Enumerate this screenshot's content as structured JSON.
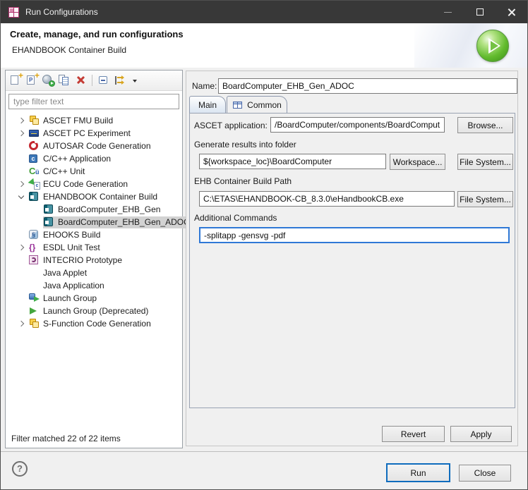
{
  "window": {
    "title": "Run Configurations"
  },
  "header": {
    "title": "Create, manage, and run configurations",
    "subtitle": "EHANDBOOK Container Build"
  },
  "left_panel": {
    "toolbar": [
      {
        "name": "new-launch-configuration-button",
        "icon": "new-config-icon"
      },
      {
        "name": "new-launch-prototype-button",
        "icon": "new-prototype-icon"
      },
      {
        "name": "export-launch-configurations-button",
        "icon": "export-icon"
      },
      {
        "name": "duplicate-launch-configuration-button",
        "icon": "duplicate-icon"
      },
      {
        "name": "delete-launch-configuration-button",
        "icon": "delete-icon"
      },
      {
        "separator": true
      },
      {
        "name": "collapse-all-button",
        "icon": "collapse-all-icon"
      },
      {
        "name": "filter-launch-configurations-button",
        "icon": "filter-icon"
      },
      {
        "name": "toolbar-menu-button",
        "icon": "dropdown-arrow-icon"
      }
    ],
    "filter_placeholder": "type filter text",
    "tree": [
      {
        "label": "ASCET FMU Build",
        "icon": "ascet-fmu-icon",
        "chevron": "collapsed"
      },
      {
        "label": "ASCET PC Experiment",
        "icon": "ascet-pc-icon",
        "chevron": "collapsed"
      },
      {
        "label": "AUTOSAR Code Generation",
        "icon": "autosar-icon"
      },
      {
        "label": "C/C++ Application",
        "icon": "c-application-icon"
      },
      {
        "label": "C/C++ Unit",
        "icon": "c-unit-icon"
      },
      {
        "label": "ECU Code Generation",
        "icon": "ecu-codegen-icon",
        "chevron": "collapsed"
      },
      {
        "label": "EHANDBOOK Container Build",
        "icon": "ehandbook-icon",
        "chevron": "expanded"
      },
      {
        "label": "BoardComputer_EHB_Gen",
        "icon": "ehandbook-icon",
        "indent": 1
      },
      {
        "label": "BoardComputer_EHB_Gen_ADOC",
        "icon": "ehandbook-icon",
        "indent": 1,
        "selected": true
      },
      {
        "label": "EHOOKS Build",
        "icon": "ehooks-icon"
      },
      {
        "label": "ESDL Unit Test",
        "icon": "esdl-icon",
        "chevron": "collapsed"
      },
      {
        "label": "INTECRIO Prototype",
        "icon": "intecrio-icon"
      },
      {
        "label": "Java Applet",
        "icon": null
      },
      {
        "label": "Java Application",
        "icon": null
      },
      {
        "label": "Launch Group",
        "icon": "launch-group-icon"
      },
      {
        "label": "Launch Group (Deprecated)",
        "icon": "launch-group-deprecated-icon"
      },
      {
        "label": "S-Function Code Generation",
        "icon": "s-function-icon",
        "chevron": "collapsed"
      }
    ],
    "status": "Filter matched 22 of 22 items"
  },
  "editor": {
    "name_label": "Name:",
    "name_value": "BoardComputer_EHB_Gen_ADOC",
    "tabs": [
      {
        "label": "Main",
        "active": true
      },
      {
        "label": "Common",
        "icon": "table-icon"
      }
    ],
    "ascet_label": "ASCET application:",
    "ascet_value": "/BoardComputer/components/BoardComput",
    "browse_button": "Browse...",
    "results_label": "Generate results into folder",
    "results_value": "${workspace_loc}\\BoardComputer",
    "workspace_button": "Workspace...",
    "file_system_button": "File System...",
    "ehb_label": "EHB Container Build Path",
    "ehb_value": "C:\\ETAS\\EHANDBOOK-CB_8.3.0\\eHandbookCB.exe",
    "commands_label": "Additional Commands",
    "commands_value": "-splitapp -gensvg -pdf",
    "revert_button": "Revert",
    "apply_button": "Apply"
  },
  "footer": {
    "help_glyph": "?",
    "run_button": "Run",
    "close_button": "Close"
  },
  "colors": {
    "titlebar": "#383838",
    "accent_blue": "#2f78d6",
    "run_border": "#0f6cbd",
    "brand_green": "#62bb2e",
    "launch_icon_pink": "#b0326e",
    "selection_gray": "#d2d2d2"
  }
}
